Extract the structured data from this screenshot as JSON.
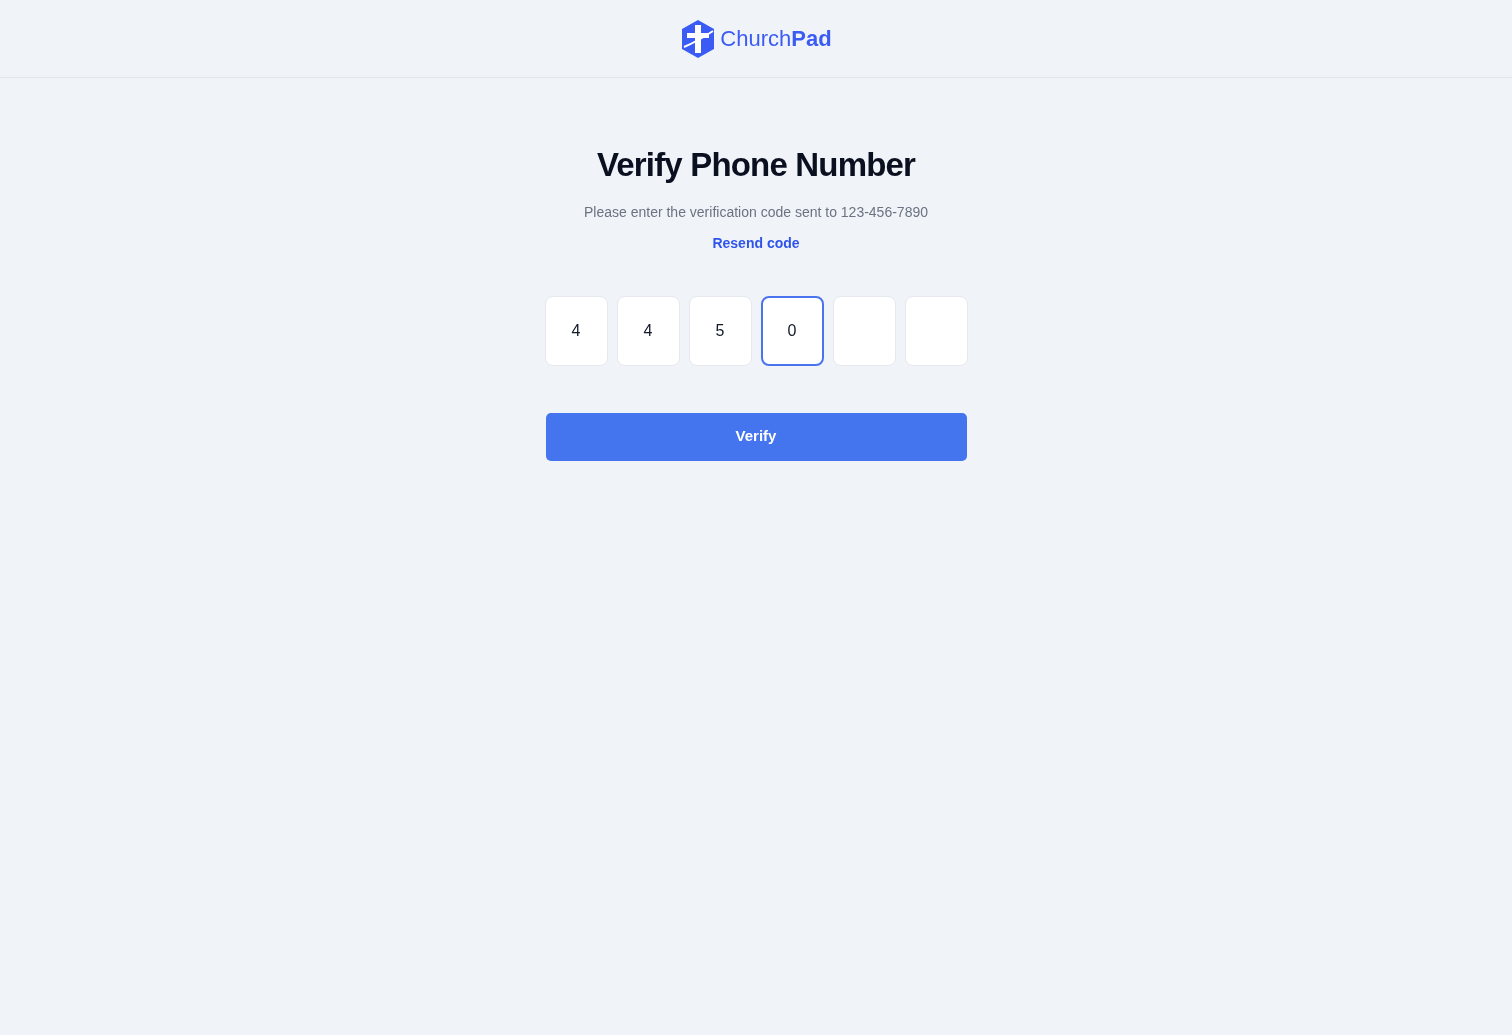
{
  "header": {
    "logo_text": "Church**Pad**"
  },
  "title": "Verify Phone Number",
  "subtitle": "Please enter the verification code sent to 123-456-7890",
  "resend_link": "Resend code",
  "code_digits": [
    {
      "value": "4",
      "focused": false
    },
    {
      "value": "4",
      "focused": false
    },
    {
      "value": "5",
      "focused": false
    },
    {
      "value": "0",
      "focused": true
    },
    {
      "focused": false
    },
    {
      "focused": false
    }
  ],
  "verify_button": "Verify"
}
